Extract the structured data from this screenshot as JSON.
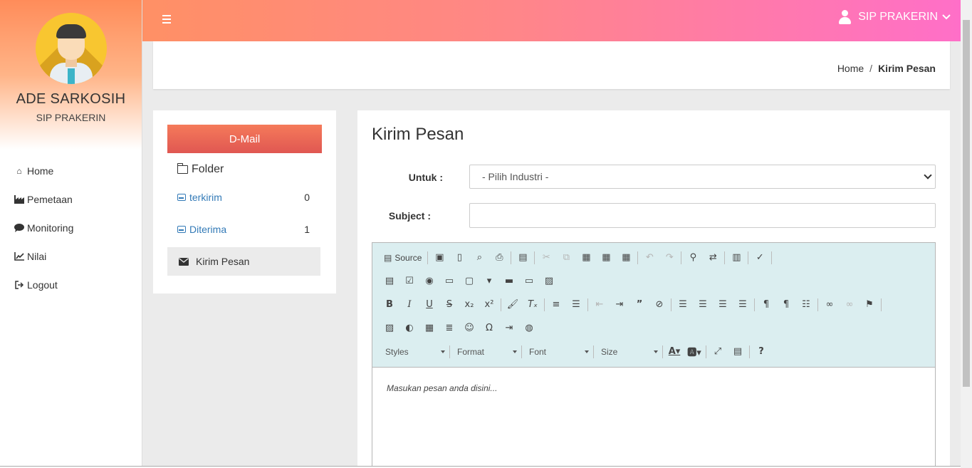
{
  "profile": {
    "name": "ADE SARKOSIH",
    "subtitle": "SIP PRAKERIN"
  },
  "menu": [
    {
      "label": "Home",
      "icon": "home-icon"
    },
    {
      "label": "Pemetaan",
      "icon": "industry-icon"
    },
    {
      "label": "Monitoring",
      "icon": "comment-icon"
    },
    {
      "label": "Nilai",
      "icon": "line-chart-icon"
    },
    {
      "label": "Logout",
      "icon": "sign-out-icon"
    }
  ],
  "topbar": {
    "user_label": "SIP PRAKERIN"
  },
  "breadcrumb": {
    "home": "Home",
    "separator": "/",
    "current": "Kirim Pesan"
  },
  "mail": {
    "button_label": "D-Mail",
    "folder_title": "Folder",
    "items": [
      {
        "label": "terkirim",
        "count": "0"
      },
      {
        "label": "Diterima",
        "count": "1"
      }
    ],
    "compose_label": "Kirim Pesan"
  },
  "compose": {
    "title": "Kirim Pesan",
    "to_label": "Untuk :",
    "to_selected": "- Pilih Industri -",
    "subject_label": "Subject :",
    "subject_value": "",
    "editor_placeholder": "Masukan pesan anda disini..."
  },
  "editor_toolbar": {
    "source_label": "Source",
    "styles_label": "Styles",
    "format_label": "Format",
    "font_label": "Font",
    "size_label": "Size"
  },
  "colors": {
    "topbar_start": "#ff9065",
    "topbar_end": "#ff6fc8",
    "dmail_button": "#e8624f",
    "link": "#337ab7",
    "editor_toolbar_bg": "#dbeef0"
  }
}
